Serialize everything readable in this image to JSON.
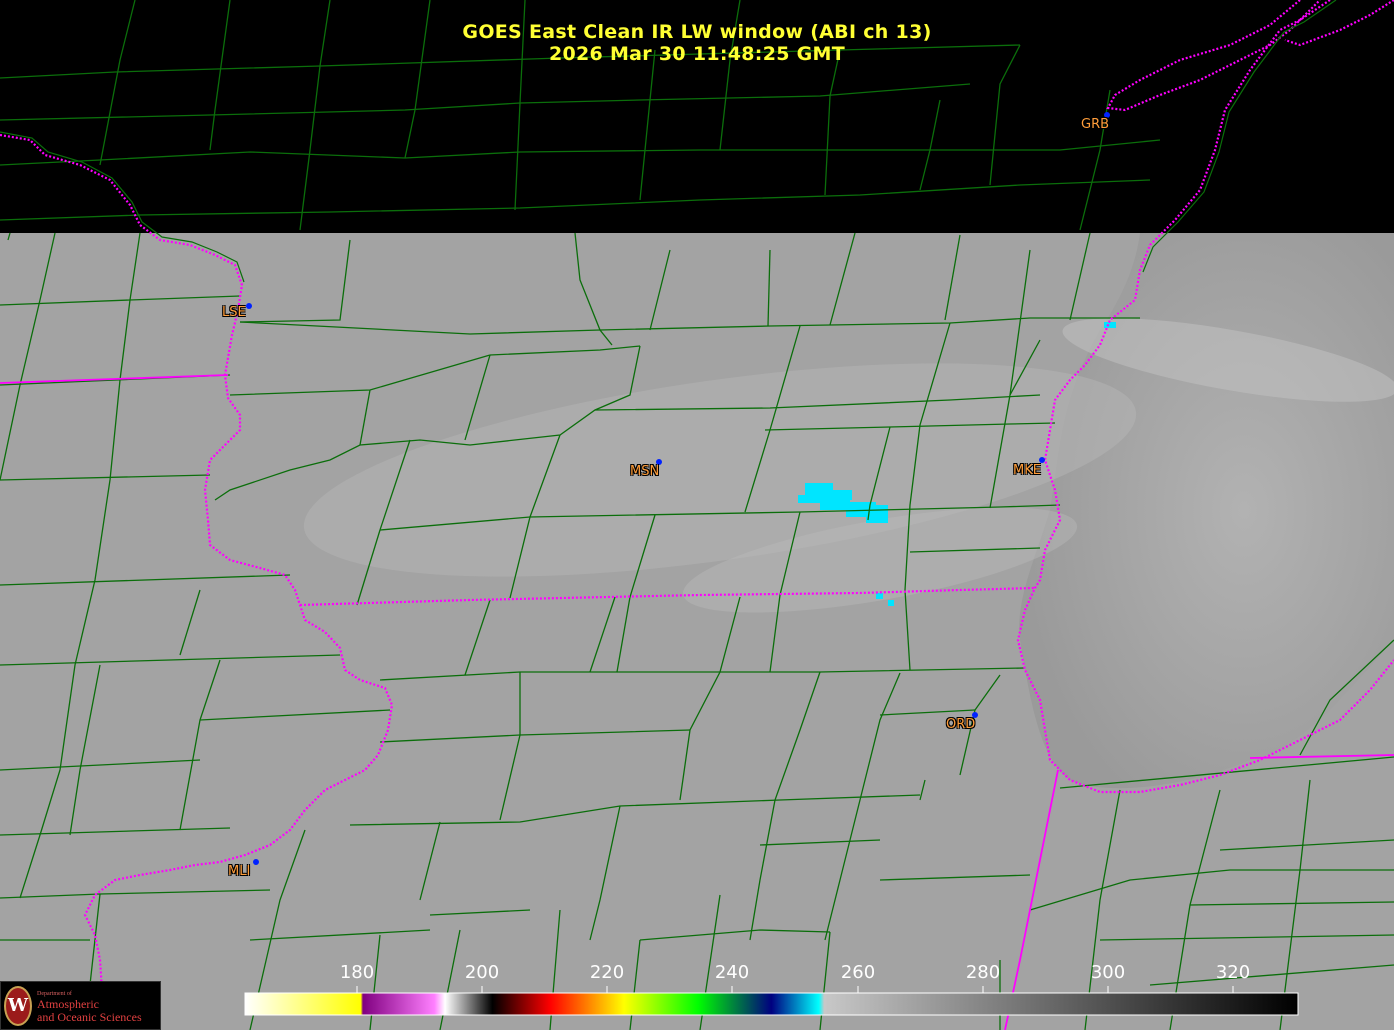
{
  "title": {
    "line1": "GOES East Clean IR LW window (ABI ch 13)",
    "line2": "2026 Mar 30  11:48:25 GMT"
  },
  "cities": [
    {
      "label": "GRB"
    },
    {
      "label": "LSE"
    },
    {
      "label": "MSN"
    },
    {
      "label": "MKE"
    },
    {
      "label": "ORD"
    },
    {
      "label": "MLI"
    }
  ],
  "colorbar": {
    "ticks": [
      "180",
      "200",
      "220",
      "240",
      "260",
      "280",
      "300",
      "320"
    ],
    "colors": [
      "#ffffff",
      "#ffff00",
      "#800080",
      "#ff80ff",
      "#ffffff",
      "#000000",
      "#ff0000",
      "#ffff00",
      "#00ff00",
      "#000080",
      "#00ffff",
      "#c8c8c8",
      "#000000"
    ]
  },
  "logo": {
    "dept": "Department of",
    "line1": "Atmospheric",
    "line2": "and Oceanic Sciences",
    "crest": "W"
  },
  "colors": {
    "county_lines": "#0b6e0b",
    "state_borders": "#ff00ff",
    "title": "#ffff33",
    "city_label": "#ff9d3a",
    "cold_cloud": "#00ffff"
  }
}
